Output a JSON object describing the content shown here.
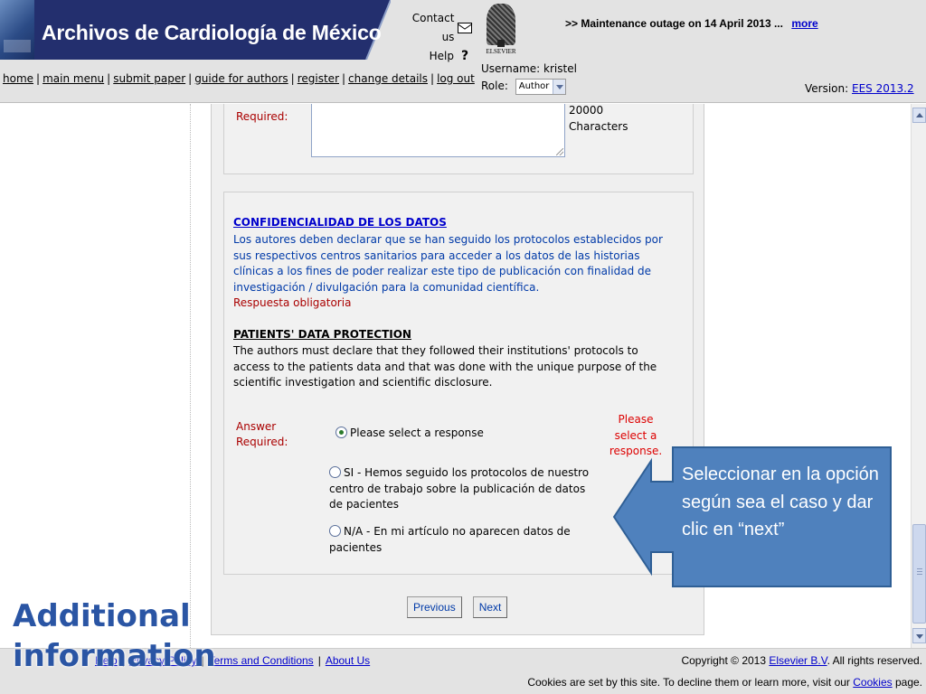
{
  "header": {
    "journal_title": "Archivos de Cardiología de México",
    "contact_label": "Contact us",
    "help_label": "Help",
    "help_glyph": "?",
    "elsevier_label": "ELSEVIER",
    "maintenance_text": ">> Maintenance outage on 14 April 2013 ...",
    "maintenance_link": "more",
    "username_label": "Username: kristel",
    "role_label": "Role:",
    "role_value": "Author",
    "version_label": "Version:",
    "version_link": "EES 2013.2",
    "brand_color": "#232f6e",
    "nav": [
      {
        "label": "home"
      },
      {
        "label": "main menu"
      },
      {
        "label": "submit paper"
      },
      {
        "label": "guide for authors"
      },
      {
        "label": "register"
      },
      {
        "label": "change details"
      },
      {
        "label": "log out"
      }
    ]
  },
  "form": {
    "prev_required_label": "Required:",
    "char_limit_line1": "20000",
    "char_limit_line2": "Characters",
    "spanish_heading": "CONFIDENCIALIDAD DE LOS DATOS",
    "spanish_body": "Los autores deben declarar que se han seguido los protocolos establecidos por sus respectivos centros sanitarios para acceder a los datos de las historias clínicas a los fines de poder realizar este tipo de publicación con finalidad de investigación / divulgación para la comunidad científica.",
    "mandatory_note": "Respuesta obligatoria",
    "english_heading": "PATIENTS' DATA PROTECTION",
    "english_body": "The authors must declare that they followed their institutions' protocols to access to the patients data and that was done with the unique purpose of the scientific investigation and scientific disclosure.",
    "answer_label_line1": "Answer",
    "answer_label_line2": "Required:",
    "validation_line1": "Please",
    "validation_line2": "select a",
    "validation_line3": "response.",
    "options": [
      {
        "label": "Please select a response",
        "checked": true
      },
      {
        "label": "SI - Hemos seguido los protocolos de nuestro centro de trabajo sobre la publicación de datos de pacientes",
        "checked": false
      },
      {
        "label": "N/A - En mi artículo no aparecen datos de pacientes",
        "checked": false
      }
    ],
    "previous_button": "Previous",
    "next_button": "Next"
  },
  "footer": {
    "links": [
      {
        "label": "Help"
      },
      {
        "label": "Privacy Policy"
      },
      {
        "label": "Terms and Conditions"
      },
      {
        "label": "About Us"
      }
    ],
    "copyright_prefix": "Copyright © 2013",
    "copyright_link": "Elsevier B.V",
    "copyright_suffix": ". All rights reserved.",
    "cookies_prefix": "Cookies are set by this site. To decline them or learn more, visit our",
    "cookies_link": "Cookies",
    "cookies_suffix": "page."
  },
  "overlay": {
    "title": "Additional information",
    "callout_text": "Seleccionar en la opción según sea el caso y dar clic  en “next”",
    "callout_color": "#4f81bd",
    "title_color": "#2a55a4"
  }
}
